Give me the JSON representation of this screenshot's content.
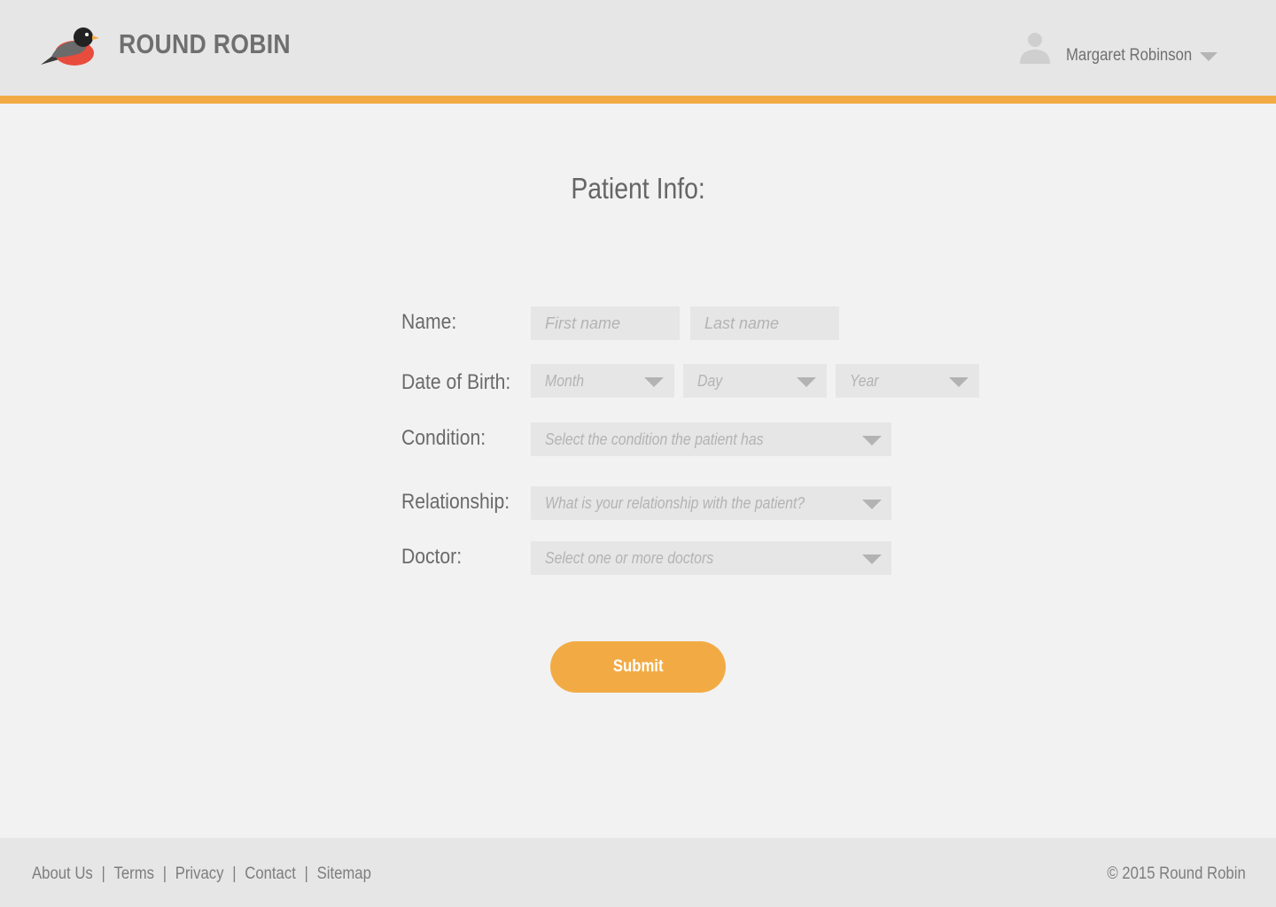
{
  "header": {
    "app_title": "ROUND ROBIN",
    "user_name": "Margaret Robinson",
    "logo_icon": "robin-bird-icon",
    "user_icon": "user-silhouette-icon"
  },
  "form": {
    "title": "Patient Info:",
    "name": {
      "label": "Name:",
      "first_placeholder": "First name",
      "last_placeholder": "Last name"
    },
    "dob": {
      "label": "Date of Birth:",
      "month": "Month",
      "day": "Day",
      "year": "Year"
    },
    "condition": {
      "label": "Condition:",
      "placeholder": "Select the condition the patient has"
    },
    "relationship": {
      "label": "Relationship:",
      "placeholder": "What is your relationship with the patient?"
    },
    "doctor": {
      "label": "Doctor:",
      "placeholder": "Select one or more doctors"
    },
    "submit_label": "Submit"
  },
  "footer": {
    "links": [
      "About Us",
      "Terms",
      "Privacy",
      "Contact",
      "Sitemap"
    ],
    "separator": "|",
    "copyright": "© 2015 Round Robin"
  },
  "colors": {
    "accent": "#f2ab44",
    "header_bg": "#e6e6e6",
    "page_bg": "#f2f2f2",
    "field_bg": "#e6e6e6",
    "robin_red": "#e84c3d"
  }
}
